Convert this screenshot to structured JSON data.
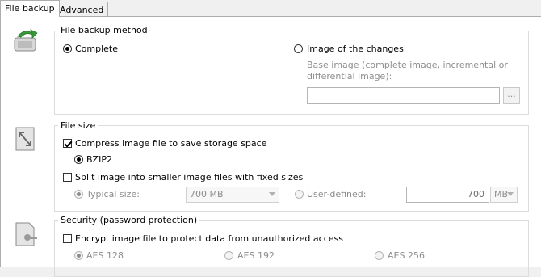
{
  "tabs": [
    {
      "label": "File backup",
      "active": true
    },
    {
      "label": "Advanced",
      "active": false
    }
  ],
  "backup_method": {
    "title": "File backup method",
    "complete_label": "Complete",
    "image_changes_label": "Image of the changes",
    "selected": "Complete",
    "base_image_label_line1": "Base image (complete image, incremental or",
    "base_image_label_line2": "differential image):",
    "base_image_value": "",
    "browse_label": "..."
  },
  "file_size": {
    "title": "File size",
    "compress_label": "Compress image file to save storage space",
    "compress_checked": true,
    "bzip2_label": "BZIP2",
    "split_label": "Split image into smaller image files with fixed sizes",
    "split_checked": false,
    "typical_size_label": "Typical size:",
    "typical_size_value": "700 MB",
    "user_defined_label": "User-defined:",
    "user_defined_value": "700",
    "unit_value": "MB"
  },
  "security": {
    "title": "Security (password protection)",
    "encrypt_label": "Encrypt image file to protect data from unauthorized access",
    "encrypt_checked": false,
    "aes128_label": "AES 128",
    "aes192_label": "AES 192",
    "aes256_label": "AES 256"
  },
  "colors": {
    "accent_green": "#3a9a3a",
    "disabled_text": "#8d8d8d"
  },
  "icons": [
    "backup-method-icon",
    "file-size-icon",
    "security-icon"
  ]
}
